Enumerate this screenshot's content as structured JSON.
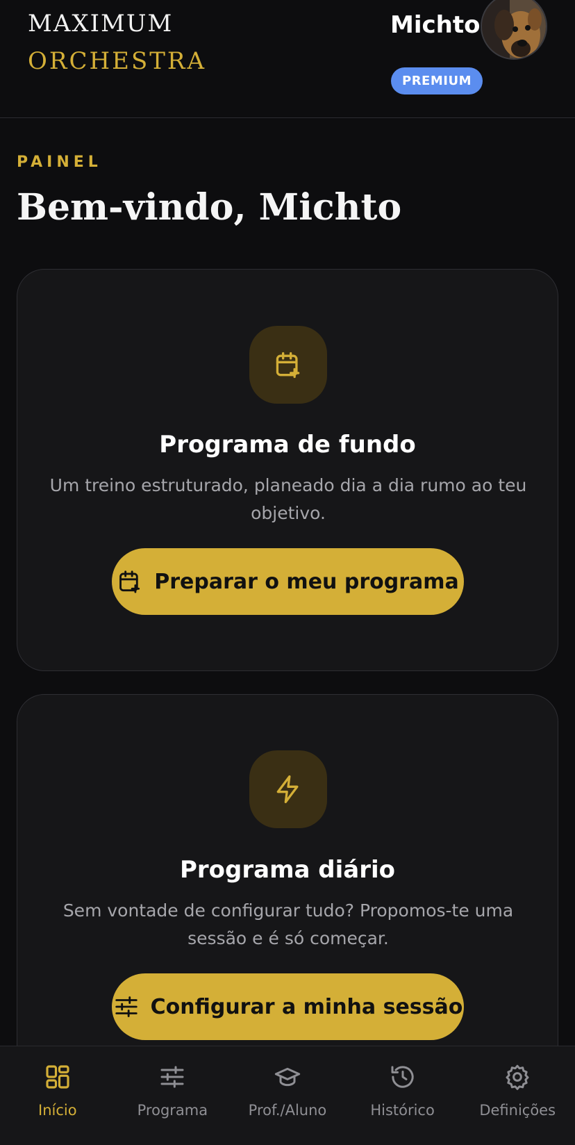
{
  "header": {
    "logo_top": "MAXIMUM",
    "logo_bottom": "ORCHESTRA",
    "user_name": "Michto",
    "badge": "PREMIUM"
  },
  "main": {
    "eyebrow": "PAINEL",
    "title": "Bem-vindo, Michto"
  },
  "cards": [
    {
      "icon": "calendar-plus-icon",
      "title": "Programa de fundo",
      "description": "Um treino estruturado, planeado dia a dia rumo ao teu objetivo.",
      "button_label": "Preparar o meu programa",
      "button_icon": "calendar-plus-icon"
    },
    {
      "icon": "lightning-icon",
      "title": "Programa diário",
      "description": "Sem vontade de configurar tudo? Propomos-te uma sessão e é só começar.",
      "button_label": "Configurar a minha sessão",
      "button_icon": "sliders-icon"
    }
  ],
  "nav": {
    "items": [
      {
        "label": "Início",
        "icon": "grid-icon",
        "active": true
      },
      {
        "label": "Programa",
        "icon": "sliders-icon",
        "active": false
      },
      {
        "label": "Prof./Aluno",
        "icon": "graduation-cap-icon",
        "active": false
      },
      {
        "label": "Histórico",
        "icon": "history-icon",
        "active": false
      },
      {
        "label": "Definições",
        "icon": "gear-icon",
        "active": false
      }
    ]
  },
  "colors": {
    "background": "#0d0d0f",
    "card": "#161618",
    "accent": "#d4af37",
    "badge": "#5b8def",
    "muted": "#8f8f94"
  }
}
